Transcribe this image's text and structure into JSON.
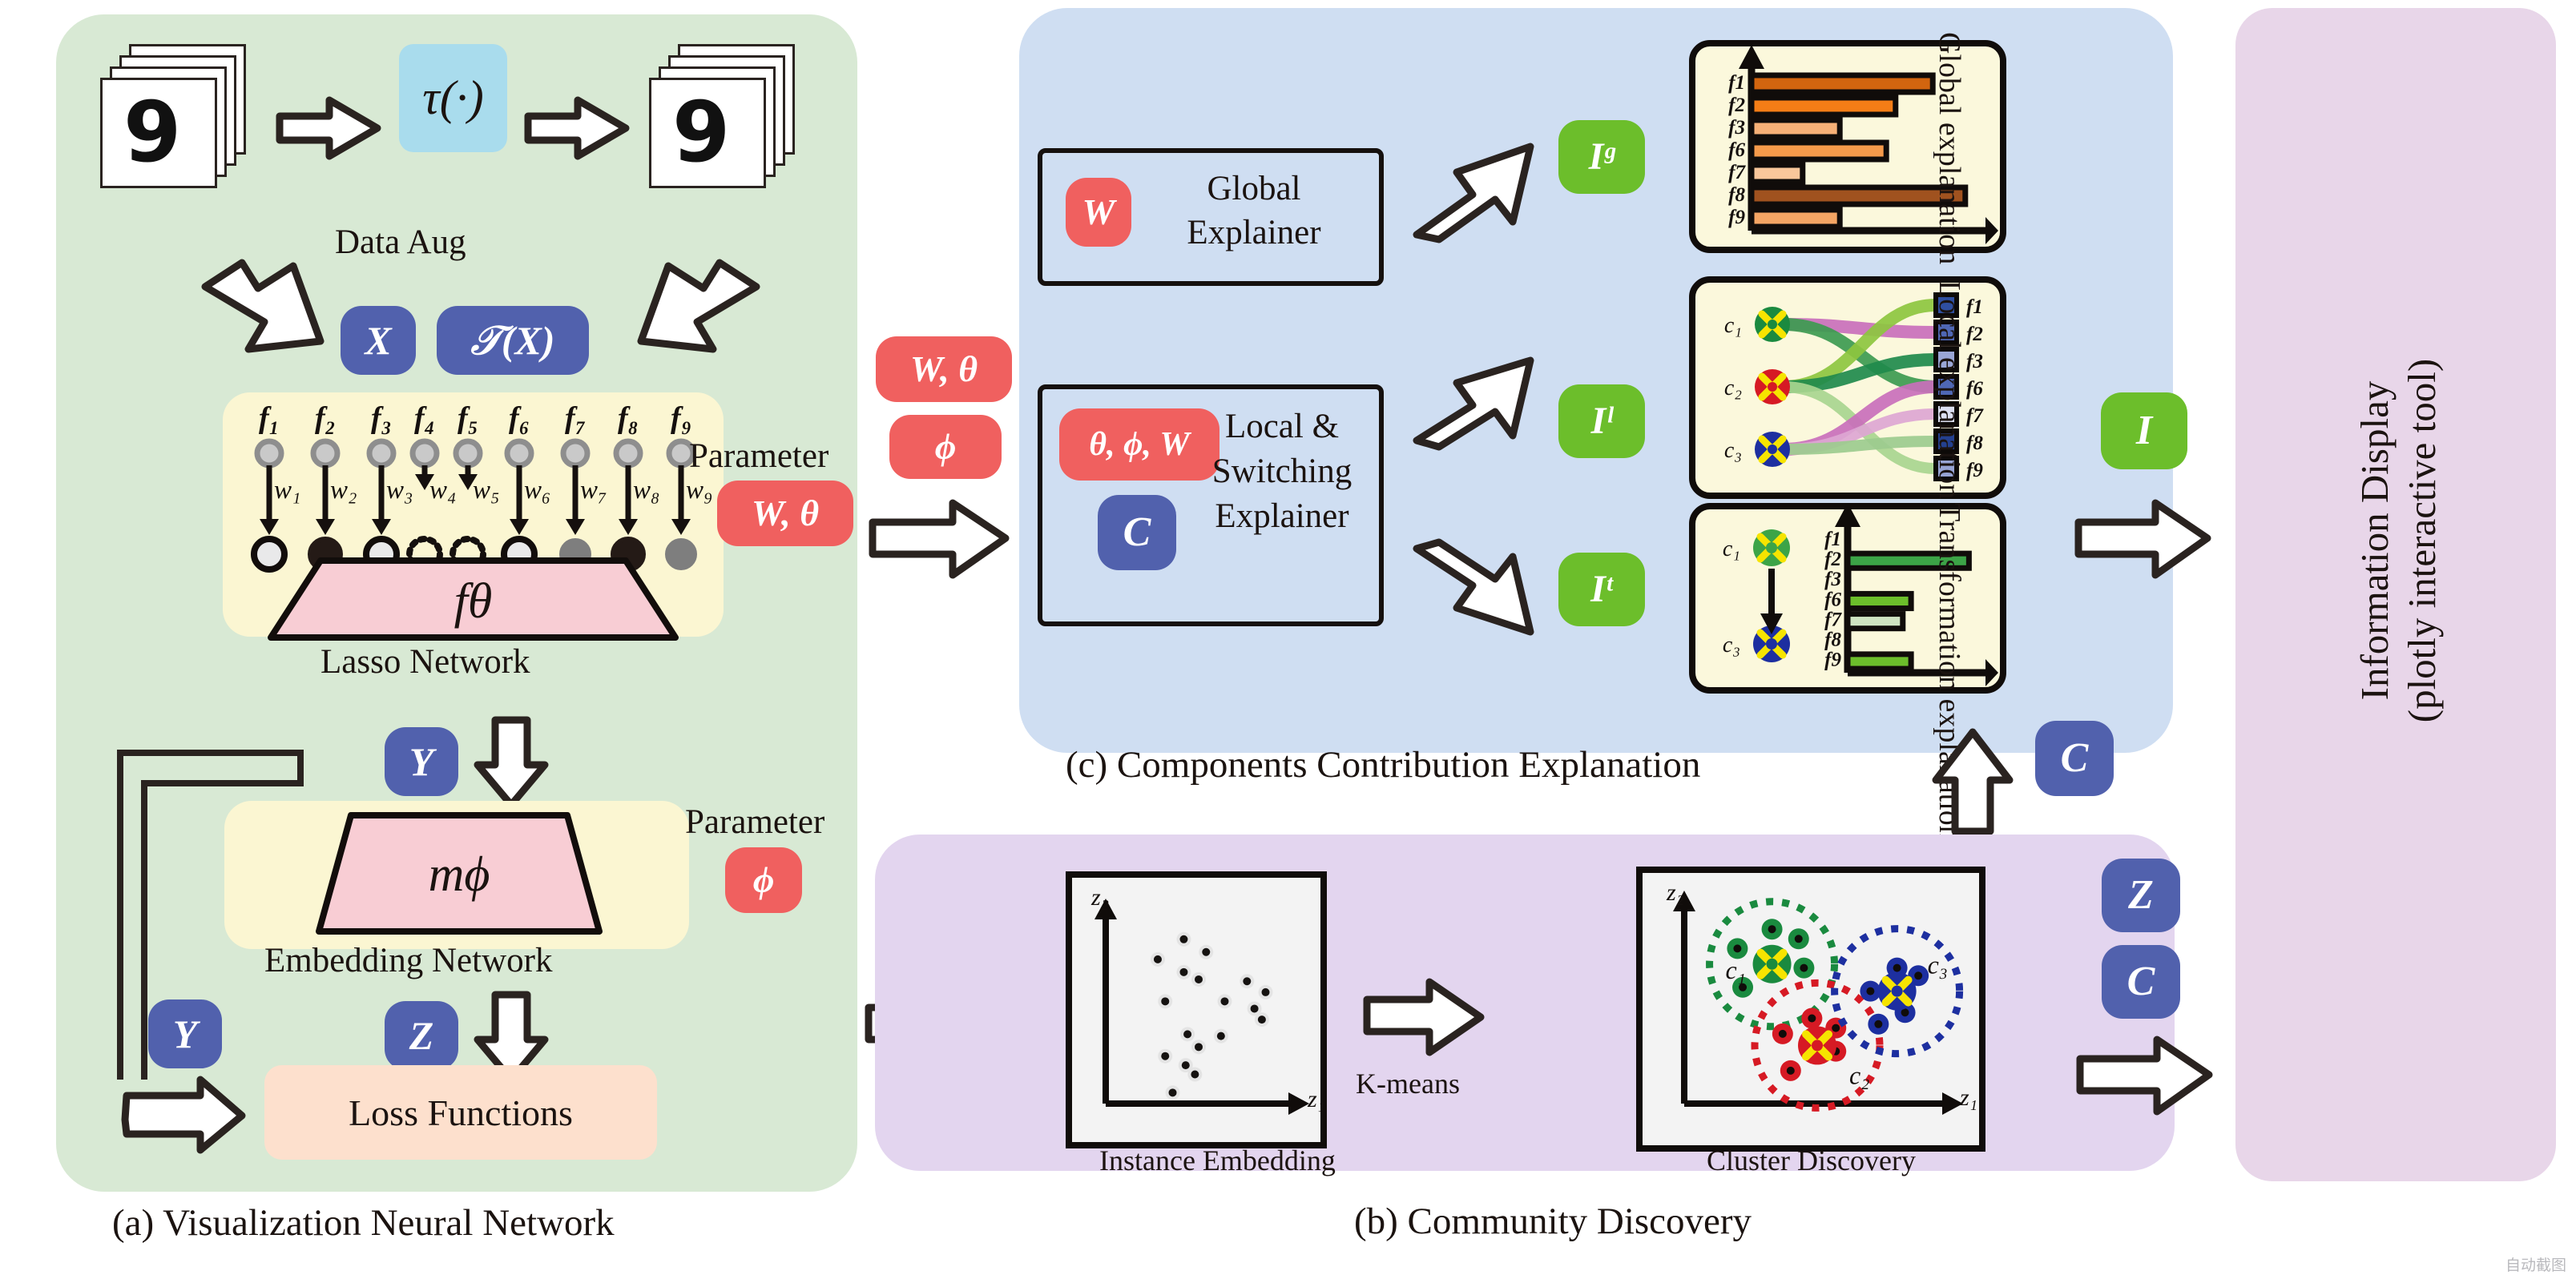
{
  "panels": {
    "a": {
      "caption": "(a) Visualization Neural Network",
      "data_aug_label": "Data Aug",
      "tau_label": "τ(·)",
      "x_badge": "X",
      "tx_badge": "𝒯(X)",
      "lasso_caption": "Lasso Network",
      "lasso_fn": "fθ",
      "embed_caption": "Embedding Network",
      "embed_fn": "mϕ",
      "loss_label": "Loss Functions",
      "param_label_1": "Parameter",
      "param_badge_1": "W, θ",
      "param_label_2": "Parameter",
      "param_badge_2": "ϕ",
      "y_badge": "Y",
      "y_badge_2": "Y",
      "z_badge": "Z",
      "features": [
        "f₁",
        "f₂",
        "f₃",
        "f₄",
        "f₅",
        "f₆",
        "f₇",
        "f₈",
        "f₉"
      ],
      "weights": [
        "w₁",
        "w₂",
        "w₃",
        "w₄",
        "w₅",
        "w₆",
        "w₇",
        "w₈",
        "w₉"
      ],
      "node_states": [
        "open",
        "filled",
        "open",
        "dotted",
        "dotted",
        "open",
        "grey",
        "filled",
        "grey"
      ]
    },
    "b": {
      "caption": "(b) Community Discovery",
      "z_in_badge": "Z",
      "left_title": "Instance Embedding",
      "right_title": "Cluster Discovery",
      "kmeans_label": "K-means",
      "axis_x": "z₁",
      "axis_y": "z₂",
      "clusters": [
        "c₁",
        "c₂",
        "c₃"
      ],
      "out_badges": [
        "Z",
        "C"
      ]
    },
    "c": {
      "caption": "(c) Components Contribution Explanation",
      "in_badges": [
        "W, θ",
        "ϕ"
      ],
      "c_badge": "C",
      "global_box": {
        "badge": "W",
        "line1": "Global",
        "line2": "Explainer"
      },
      "local_box": {
        "badge1": "θ, ϕ, W",
        "badge2": "C",
        "line1": "Local &",
        "line2": "Switching",
        "line3": "Explainer"
      },
      "out_badges": [
        "Iᵍ",
        "Iˡ",
        "Iᵗ"
      ],
      "side_labels": [
        "Global\nexplanation",
        "Local\nexplanation",
        "Transformation\nexplanation"
      ],
      "info_badge": "I"
    },
    "d": {
      "title_line1": "Information Display",
      "title_line2": "(plotly interactive tool)"
    }
  },
  "chart_data": [
    {
      "type": "bar",
      "title": "Global explanation",
      "orientation": "horizontal",
      "categories": [
        "f1",
        "f2",
        "f3",
        "f6",
        "f7",
        "f8",
        "f9"
      ],
      "values": [
        78,
        62,
        38,
        58,
        22,
        92,
        38
      ],
      "colors": [
        "#d2650f",
        "#f47d16",
        "#f6b077",
        "#f59a4b",
        "#f9c79b",
        "#a0521f",
        "#f4a564"
      ],
      "xlabel": "",
      "ylabel": "",
      "xlim": [
        0,
        100
      ],
      "grid": false,
      "legend": false
    },
    {
      "type": "sankey",
      "title": "Local explanation",
      "sources": [
        "c₁",
        "c₂",
        "c₃"
      ],
      "targets": [
        "f1",
        "f2",
        "f3",
        "f6",
        "f7",
        "f8",
        "f9"
      ],
      "target_colors": [
        "#2f4fa0",
        "#4f67b4",
        "#9aa6d6",
        "#4f67b4",
        "#dcdff0",
        "#24408f",
        "#97a4d4"
      ],
      "links": [
        {
          "source": "c₁",
          "target": "f2",
          "color": "#c96fbb",
          "width": 16
        },
        {
          "source": "c₁",
          "target": "f6",
          "color": "#3d9a50",
          "width": 16
        },
        {
          "source": "c₂",
          "target": "f1",
          "color": "#8dc63f",
          "width": 16
        },
        {
          "source": "c₂",
          "target": "f3",
          "color": "#1f8a4c",
          "width": 16
        },
        {
          "source": "c₂",
          "target": "f9",
          "color": "#a8d58f",
          "width": 14
        },
        {
          "source": "c₃",
          "target": "f6",
          "color": "#c96fbb",
          "width": 16
        },
        {
          "source": "c₃",
          "target": "f7",
          "color": "#dda6d2",
          "width": 14
        },
        {
          "source": "c₃",
          "target": "f8",
          "color": "#9ccb8e",
          "width": 14
        }
      ]
    },
    {
      "type": "bar",
      "title": "Transformation explanation",
      "orientation": "horizontal",
      "transition": {
        "from": "c₁",
        "to": "c₃"
      },
      "categories": [
        "f1",
        "f2",
        "f3",
        "f6",
        "f7",
        "f8",
        "f9"
      ],
      "values": [
        0,
        88,
        0,
        46,
        40,
        0,
        46
      ],
      "colors": [
        "#3ca447",
        "#3ca447",
        "#3ca447",
        "#6cbe2b",
        "#cfe4c2",
        "#3ca447",
        "#6cbe2b"
      ],
      "xlabel": "",
      "ylabel": "",
      "xlim": [
        0,
        100
      ],
      "grid": false,
      "legend": false
    },
    {
      "type": "scatter",
      "title": "Instance Embedding",
      "xlabel": "z₁",
      "ylabel": "z₂",
      "points": [
        [
          0.42,
          0.9
        ],
        [
          0.54,
          0.83
        ],
        [
          0.28,
          0.79
        ],
        [
          0.42,
          0.72
        ],
        [
          0.5,
          0.68
        ],
        [
          0.76,
          0.67
        ],
        [
          0.86,
          0.61
        ],
        [
          0.32,
          0.56
        ],
        [
          0.64,
          0.56
        ],
        [
          0.8,
          0.52
        ],
        [
          0.84,
          0.46
        ],
        [
          0.44,
          0.38
        ],
        [
          0.62,
          0.37
        ],
        [
          0.5,
          0.31
        ],
        [
          0.32,
          0.26
        ],
        [
          0.43,
          0.21
        ],
        [
          0.48,
          0.16
        ],
        [
          0.36,
          0.06
        ]
      ]
    },
    {
      "type": "scatter",
      "title": "Cluster Discovery",
      "xlabel": "z₁",
      "ylabel": "z₂",
      "clusters": [
        {
          "name": "c₁",
          "color": "#1a8a3f",
          "centroid": [
            0.33,
            0.72
          ],
          "points": [
            [
              0.33,
              0.9
            ],
            [
              0.43,
              0.85
            ],
            [
              0.2,
              0.8
            ],
            [
              0.45,
              0.7
            ],
            [
              0.22,
              0.6
            ]
          ]
        },
        {
          "name": "c₂",
          "color": "#d61a24",
          "centroid": [
            0.5,
            0.3
          ],
          "points": [
            [
              0.48,
              0.44
            ],
            [
              0.57,
              0.39
            ],
            [
              0.37,
              0.36
            ],
            [
              0.57,
              0.27
            ],
            [
              0.4,
              0.17
            ]
          ]
        },
        {
          "name": "c₃",
          "color": "#1d2fa0",
          "centroid": [
            0.8,
            0.58
          ],
          "points": [
            [
              0.8,
              0.7
            ],
            [
              0.88,
              0.66
            ],
            [
              0.7,
              0.58
            ],
            [
              0.83,
              0.47
            ],
            [
              0.73,
              0.41
            ]
          ]
        }
      ]
    }
  ],
  "watermark": "自动截图"
}
